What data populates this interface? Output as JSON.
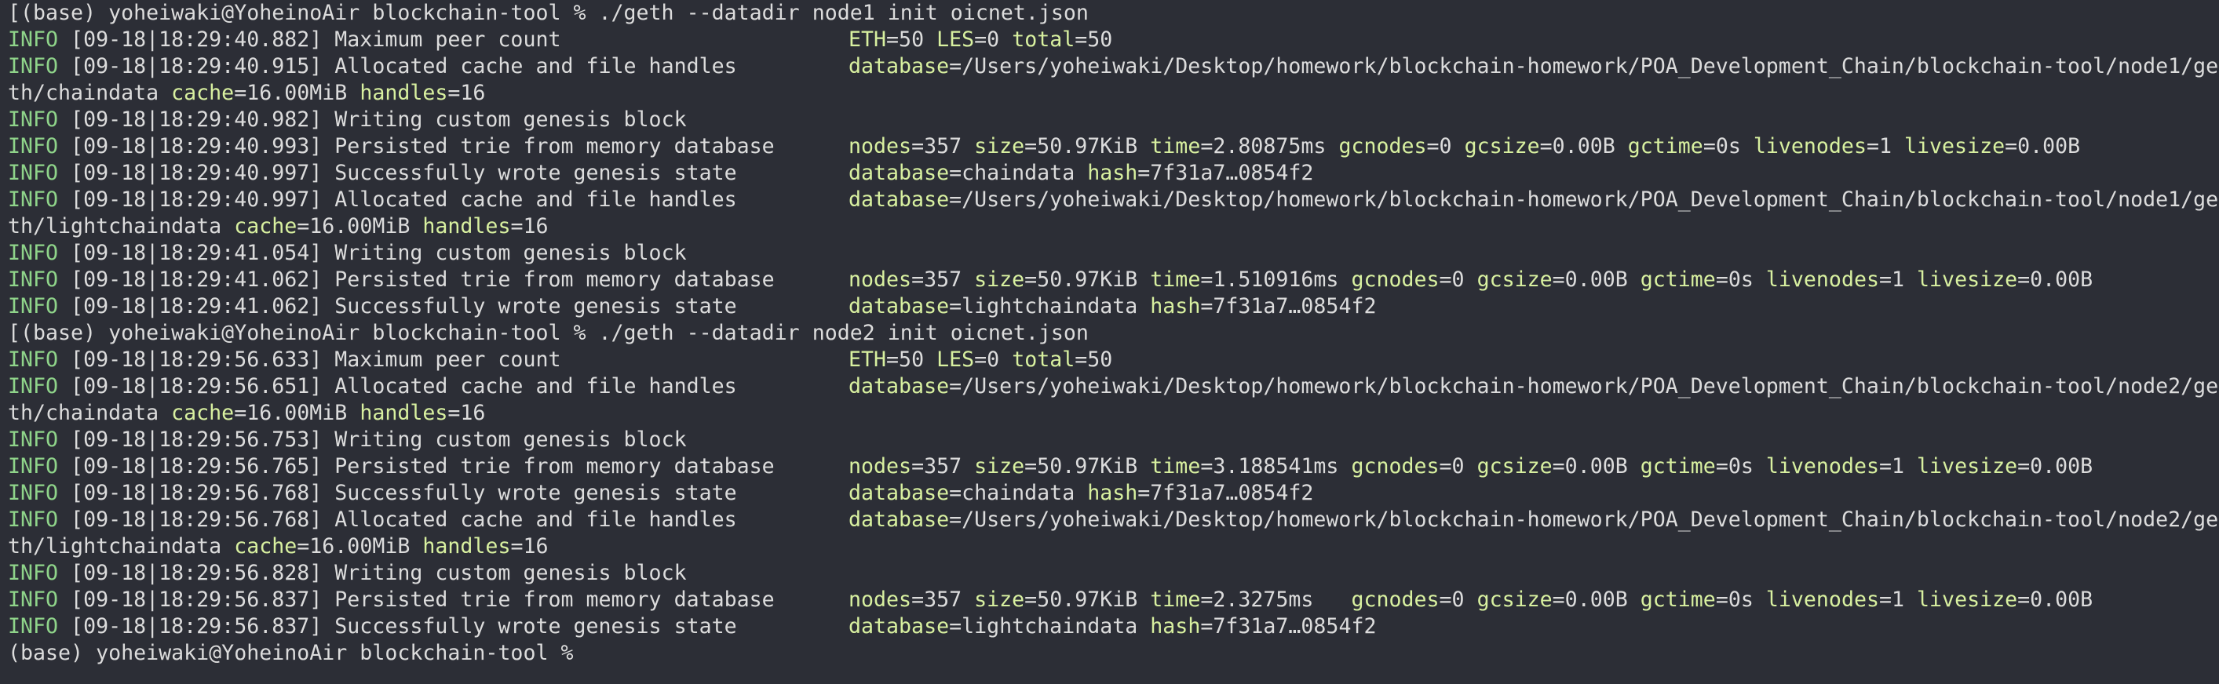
{
  "terminal": {
    "lines": [
      {
        "kind": "prompt",
        "text": "[(base) yoheiwaki@YoheinoAir blockchain-tool % ./geth --datadir node1 init oicnet.json"
      },
      {
        "kind": "log",
        "level": "INFO",
        "msg": " [09-18|18:29:40.882] Maximum peer count",
        "fields": [
          [
            "ETH",
            "=50 "
          ],
          [
            "LES",
            "=0 "
          ],
          [
            "total",
            "=50"
          ]
        ]
      },
      {
        "kind": "log",
        "level": "INFO",
        "msg": " [09-18|18:29:40.915] Allocated cache and file handles",
        "fields": [
          [
            "database",
            "=/Users/yoheiwaki/Desktop/homework/blockchain-homework/POA_Development_Chain/blockchain-tool/node1/ge"
          ]
        ]
      },
      {
        "kind": "wrap",
        "text": "th/chaindata ",
        "fields": [
          [
            "cache",
            "=16.00MiB "
          ],
          [
            "handles",
            "=16"
          ]
        ]
      },
      {
        "kind": "log",
        "level": "INFO",
        "msg": " [09-18|18:29:40.982] Writing custom genesis block",
        "fields": []
      },
      {
        "kind": "log",
        "level": "INFO",
        "msg": " [09-18|18:29:40.993] Persisted trie from memory database",
        "fields": [
          [
            "nodes",
            "=357 "
          ],
          [
            "size",
            "=50.97KiB "
          ],
          [
            "time",
            "=2.80875ms "
          ],
          [
            "gcnodes",
            "=0 "
          ],
          [
            "gcsize",
            "=0.00B "
          ],
          [
            "gctime",
            "=0s "
          ],
          [
            "livenodes",
            "=1 "
          ],
          [
            "livesize",
            "=0.00B"
          ]
        ]
      },
      {
        "kind": "log",
        "level": "INFO",
        "msg": " [09-18|18:29:40.997] Successfully wrote genesis state",
        "fields": [
          [
            "database",
            "=chaindata "
          ],
          [
            "hash",
            "=7f31a7…0854f2"
          ]
        ]
      },
      {
        "kind": "log",
        "level": "INFO",
        "msg": " [09-18|18:29:40.997] Allocated cache and file handles",
        "fields": [
          [
            "database",
            "=/Users/yoheiwaki/Desktop/homework/blockchain-homework/POA_Development_Chain/blockchain-tool/node1/ge"
          ]
        ]
      },
      {
        "kind": "wrap",
        "text": "th/lightchaindata ",
        "fields": [
          [
            "cache",
            "=16.00MiB "
          ],
          [
            "handles",
            "=16"
          ]
        ]
      },
      {
        "kind": "log",
        "level": "INFO",
        "msg": " [09-18|18:29:41.054] Writing custom genesis block",
        "fields": []
      },
      {
        "kind": "log",
        "level": "INFO",
        "msg": " [09-18|18:29:41.062] Persisted trie from memory database",
        "fields": [
          [
            "nodes",
            "=357 "
          ],
          [
            "size",
            "=50.97KiB "
          ],
          [
            "time",
            "=1.510916ms "
          ],
          [
            "gcnodes",
            "=0 "
          ],
          [
            "gcsize",
            "=0.00B "
          ],
          [
            "gctime",
            "=0s "
          ],
          [
            "livenodes",
            "=1 "
          ],
          [
            "livesize",
            "=0.00B"
          ]
        ]
      },
      {
        "kind": "log",
        "level": "INFO",
        "msg": " [09-18|18:29:41.062] Successfully wrote genesis state",
        "fields": [
          [
            "database",
            "=lightchaindata "
          ],
          [
            "hash",
            "=7f31a7…0854f2"
          ]
        ]
      },
      {
        "kind": "prompt",
        "text": "[(base) yoheiwaki@YoheinoAir blockchain-tool % ./geth --datadir node2 init oicnet.json"
      },
      {
        "kind": "log",
        "level": "INFO",
        "msg": " [09-18|18:29:56.633] Maximum peer count",
        "fields": [
          [
            "ETH",
            "=50 "
          ],
          [
            "LES",
            "=0 "
          ],
          [
            "total",
            "=50"
          ]
        ]
      },
      {
        "kind": "log",
        "level": "INFO",
        "msg": " [09-18|18:29:56.651] Allocated cache and file handles",
        "fields": [
          [
            "database",
            "=/Users/yoheiwaki/Desktop/homework/blockchain-homework/POA_Development_Chain/blockchain-tool/node2/ge"
          ]
        ]
      },
      {
        "kind": "wrap",
        "text": "th/chaindata ",
        "fields": [
          [
            "cache",
            "=16.00MiB "
          ],
          [
            "handles",
            "=16"
          ]
        ]
      },
      {
        "kind": "log",
        "level": "INFO",
        "msg": " [09-18|18:29:56.753] Writing custom genesis block",
        "fields": []
      },
      {
        "kind": "log",
        "level": "INFO",
        "msg": " [09-18|18:29:56.765] Persisted trie from memory database",
        "fields": [
          [
            "nodes",
            "=357 "
          ],
          [
            "size",
            "=50.97KiB "
          ],
          [
            "time",
            "=3.188541ms "
          ],
          [
            "gcnodes",
            "=0 "
          ],
          [
            "gcsize",
            "=0.00B "
          ],
          [
            "gctime",
            "=0s "
          ],
          [
            "livenodes",
            "=1 "
          ],
          [
            "livesize",
            "=0.00B"
          ]
        ]
      },
      {
        "kind": "log",
        "level": "INFO",
        "msg": " [09-18|18:29:56.768] Successfully wrote genesis state",
        "fields": [
          [
            "database",
            "=chaindata "
          ],
          [
            "hash",
            "=7f31a7…0854f2"
          ]
        ]
      },
      {
        "kind": "log",
        "level": "INFO",
        "msg": " [09-18|18:29:56.768] Allocated cache and file handles",
        "fields": [
          [
            "database",
            "=/Users/yoheiwaki/Desktop/homework/blockchain-homework/POA_Development_Chain/blockchain-tool/node2/ge"
          ]
        ]
      },
      {
        "kind": "wrap",
        "text": "th/lightchaindata ",
        "fields": [
          [
            "cache",
            "=16.00MiB "
          ],
          [
            "handles",
            "=16"
          ]
        ]
      },
      {
        "kind": "log",
        "level": "INFO",
        "msg": " [09-18|18:29:56.828] Writing custom genesis block",
        "fields": []
      },
      {
        "kind": "log",
        "level": "INFO",
        "msg": " [09-18|18:29:56.837] Persisted trie from memory database",
        "fields": [
          [
            "nodes",
            "=357 "
          ],
          [
            "size",
            "=50.97KiB "
          ],
          [
            "time",
            "=2.3275ms   "
          ],
          [
            "gcnodes",
            "=0 "
          ],
          [
            "gcsize",
            "=0.00B "
          ],
          [
            "gctime",
            "=0s "
          ],
          [
            "livenodes",
            "=1 "
          ],
          [
            "livesize",
            "=0.00B"
          ]
        ]
      },
      {
        "kind": "log",
        "level": "INFO",
        "msg": " [09-18|18:29:56.837] Successfully wrote genesis state",
        "fields": [
          [
            "database",
            "=lightchaindata "
          ],
          [
            "hash",
            "=7f31a7…0854f2"
          ]
        ]
      },
      {
        "kind": "prompt",
        "text": "(base) yoheiwaki@YoheinoAir blockchain-tool % "
      }
    ]
  },
  "colors": {
    "background": "#2c2e36",
    "text": "#dcdcdc",
    "level": "#8fd48a",
    "field_key": "#d8f0a0"
  }
}
